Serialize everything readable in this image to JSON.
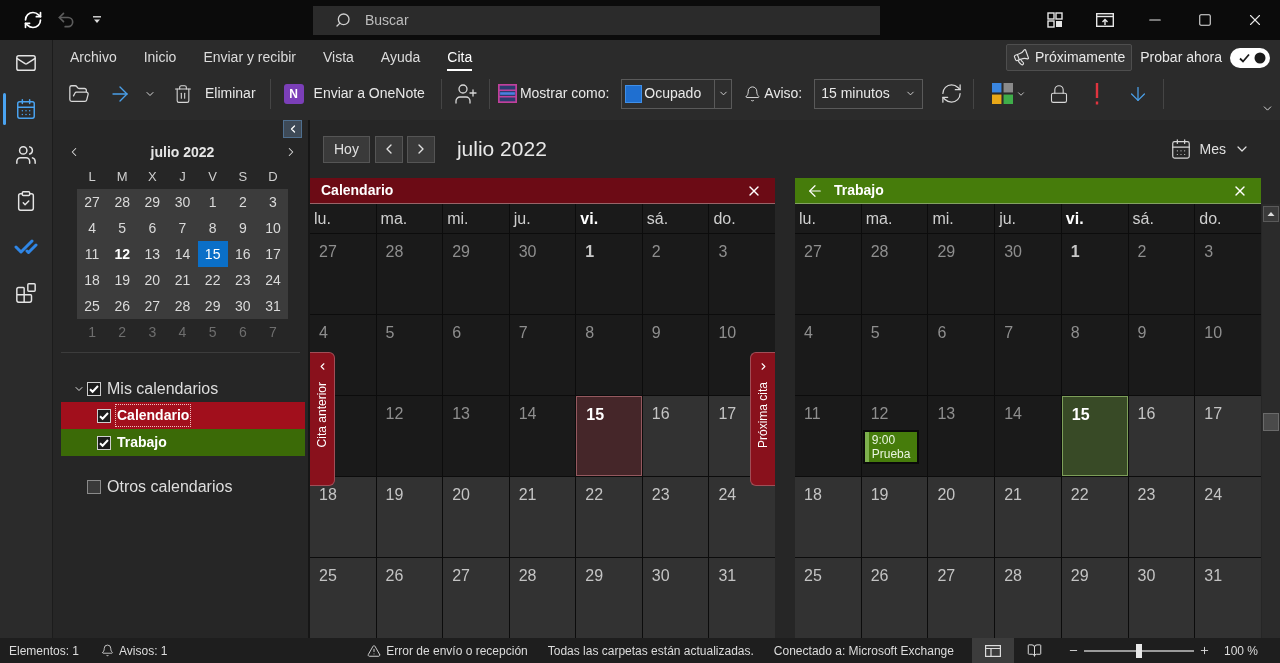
{
  "title_bar": {
    "search": {
      "placeholder": "Buscar"
    }
  },
  "nav_rail": {
    "items": [
      {
        "kind": "mail",
        "selected": false
      },
      {
        "kind": "calendar",
        "selected": true
      },
      {
        "kind": "people",
        "selected": false
      },
      {
        "kind": "tasks",
        "selected": false
      },
      {
        "kind": "todo",
        "selected": false
      },
      {
        "kind": "apps",
        "selected": false
      }
    ]
  },
  "ribbon": {
    "tabs": [
      {
        "label": "Archivo",
        "selected": false
      },
      {
        "label": "Inicio",
        "selected": false
      },
      {
        "label": "Enviar y recibir",
        "selected": false
      },
      {
        "label": "Vista",
        "selected": false
      },
      {
        "label": "Ayuda",
        "selected": false
      },
      {
        "label": "Cita",
        "selected": true
      }
    ],
    "coming_soon": {
      "label": "Próximamente"
    },
    "try_now": {
      "label": "Probar ahora",
      "on": true
    },
    "toolbar": {
      "delete": {
        "label": "Eliminar"
      },
      "onenote": {
        "logo": "N",
        "label": "Enviar a OneNote"
      },
      "show_as": {
        "label": "Mostrar como:",
        "value": "Ocupado"
      },
      "reminder": {
        "label": "Aviso:",
        "value": "15 minutos"
      }
    }
  },
  "mini_calendar": {
    "title": "julio 2022",
    "weekdays": [
      "L",
      "M",
      "X",
      "J",
      "V",
      "S",
      "D"
    ],
    "weeks": [
      {
        "dimmed": false,
        "days": [
          {
            "label": "27",
            "selected": false,
            "has_items": false
          },
          {
            "label": "28",
            "selected": false,
            "has_items": false
          },
          {
            "label": "29",
            "selected": false,
            "has_items": false
          },
          {
            "label": "30",
            "selected": false,
            "has_items": false
          },
          {
            "label": "1",
            "selected": false,
            "has_items": false
          },
          {
            "label": "2",
            "selected": false,
            "has_items": false
          },
          {
            "label": "3",
            "selected": false,
            "has_items": false
          }
        ]
      },
      {
        "dimmed": false,
        "days": [
          {
            "label": "4",
            "selected": false,
            "has_items": false
          },
          {
            "label": "5",
            "selected": false,
            "has_items": false
          },
          {
            "label": "6",
            "selected": false,
            "has_items": false
          },
          {
            "label": "7",
            "selected": false,
            "has_items": false
          },
          {
            "label": "8",
            "selected": false,
            "has_items": false
          },
          {
            "label": "9",
            "selected": false,
            "has_items": false
          },
          {
            "label": "10",
            "selected": false,
            "has_items": false
          }
        ]
      },
      {
        "dimmed": false,
        "days": [
          {
            "label": "11",
            "selected": false,
            "has_items": false
          },
          {
            "label": "12",
            "selected": false,
            "has_items": true
          },
          {
            "label": "13",
            "selected": false,
            "has_items": false
          },
          {
            "label": "14",
            "selected": false,
            "has_items": false
          },
          {
            "label": "15",
            "selected": true,
            "has_items": false
          },
          {
            "label": "16",
            "selected": false,
            "has_items": false
          },
          {
            "label": "17",
            "selected": false,
            "has_items": false
          }
        ]
      },
      {
        "dimmed": false,
        "days": [
          {
            "label": "18",
            "selected": false,
            "has_items": false
          },
          {
            "label": "19",
            "selected": false,
            "has_items": false
          },
          {
            "label": "20",
            "selected": false,
            "has_items": false
          },
          {
            "label": "21",
            "selected": false,
            "has_items": false
          },
          {
            "label": "22",
            "selected": false,
            "has_items": false
          },
          {
            "label": "23",
            "selected": false,
            "has_items": false
          },
          {
            "label": "24",
            "selected": false,
            "has_items": false
          }
        ]
      },
      {
        "dimmed": false,
        "days": [
          {
            "label": "25",
            "selected": false,
            "has_items": false
          },
          {
            "label": "26",
            "selected": false,
            "has_items": false
          },
          {
            "label": "27",
            "selected": false,
            "has_items": false
          },
          {
            "label": "28",
            "selected": false,
            "has_items": false
          },
          {
            "label": "29",
            "selected": false,
            "has_items": false
          },
          {
            "label": "30",
            "selected": false,
            "has_items": false
          },
          {
            "label": "31",
            "selected": false,
            "has_items": false
          }
        ]
      },
      {
        "dimmed": true,
        "days": [
          {
            "label": "1",
            "selected": false,
            "has_items": false
          },
          {
            "label": "2",
            "selected": false,
            "has_items": false
          },
          {
            "label": "3",
            "selected": false,
            "has_items": false
          },
          {
            "label": "4",
            "selected": false,
            "has_items": false
          },
          {
            "label": "5",
            "selected": false,
            "has_items": false
          },
          {
            "label": "6",
            "selected": false,
            "has_items": false
          },
          {
            "label": "7",
            "selected": false,
            "has_items": false
          }
        ]
      }
    ]
  },
  "calendar_list": [
    {
      "label": "Mis calendarios",
      "checked": true,
      "expanded": true,
      "children": [
        {
          "label": "Calendario",
          "checked": true,
          "focused": true,
          "color": "#a10f1c"
        },
        {
          "label": "Trabajo",
          "checked": true,
          "focused": false,
          "color": "#3b6a07"
        }
      ]
    },
    {
      "label": "Otros calendarios",
      "checked": false
    }
  ],
  "main": {
    "today_button": "Hoy",
    "title": "julio 2022",
    "view": "Mes",
    "panes": [
      {
        "kind": "primary",
        "name": "Calendario",
        "color": "#6c0b15",
        "previous_label": "Cita anterior",
        "next_label": "Próxima cita",
        "weekdays": [
          {
            "label": "lu.",
            "current": false
          },
          {
            "label": "ma.",
            "current": false
          },
          {
            "label": "mi.",
            "current": false
          },
          {
            "label": "ju.",
            "current": false
          },
          {
            "label": "vi.",
            "current": true
          },
          {
            "label": "sá.",
            "current": false
          },
          {
            "label": "do.",
            "current": false
          }
        ],
        "weeks": [
          [
            {
              "label": "27",
              "past": true,
              "today": false,
              "month_start": false
            },
            {
              "label": "28",
              "past": true,
              "today": false,
              "month_start": false
            },
            {
              "label": "29",
              "past": true,
              "today": false,
              "month_start": false
            },
            {
              "label": "30",
              "past": true,
              "today": false,
              "month_start": false
            },
            {
              "label": "1",
              "past": true,
              "today": false,
              "month_start": true
            },
            {
              "label": "2",
              "past": true,
              "today": false,
              "month_start": false
            },
            {
              "label": "3",
              "past": true,
              "today": false,
              "month_start": false
            }
          ],
          [
            {
              "label": "4",
              "past": true,
              "today": false,
              "month_start": false
            },
            {
              "label": "5",
              "past": true,
              "today": false,
              "month_start": false
            },
            {
              "label": "6",
              "past": true,
              "today": false,
              "month_start": false
            },
            {
              "label": "7",
              "past": true,
              "today": false,
              "month_start": false
            },
            {
              "label": "8",
              "past": true,
              "today": false,
              "month_start": false
            },
            {
              "label": "9",
              "past": true,
              "today": false,
              "month_start": false
            },
            {
              "label": "10",
              "past": true,
              "today": false,
              "month_start": false
            }
          ],
          [
            {
              "past": true,
              "today": false,
              "month_start": false
            },
            {
              "label": "12",
              "past": true,
              "today": false,
              "month_start": false
            },
            {
              "label": "13",
              "past": true,
              "today": false,
              "month_start": false
            },
            {
              "label": "14",
              "past": true,
              "today": false,
              "month_start": false
            },
            {
              "label": "15",
              "past": false,
              "today": true,
              "month_start": false
            },
            {
              "label": "16",
              "past": false,
              "today": false,
              "month_start": false
            },
            {
              "label": "17",
              "past": false,
              "today": false,
              "month_start": false
            }
          ],
          [
            {
              "label": "18",
              "past": false,
              "today": false,
              "month_start": false
            },
            {
              "label": "19",
              "past": false,
              "today": false,
              "month_start": false
            },
            {
              "label": "20",
              "past": false,
              "today": false,
              "month_start": false
            },
            {
              "label": "21",
              "past": false,
              "today": false,
              "month_start": false
            },
            {
              "label": "22",
              "past": false,
              "today": false,
              "month_start": false
            },
            {
              "label": "23",
              "past": false,
              "today": false,
              "month_start": false
            },
            {
              "label": "24",
              "past": false,
              "today": false,
              "month_start": false
            }
          ],
          [
            {
              "label": "25",
              "past": false,
              "today": false,
              "month_start": false
            },
            {
              "label": "26",
              "past": false,
              "today": false,
              "month_start": false
            },
            {
              "label": "27",
              "past": false,
              "today": false,
              "month_start": false
            },
            {
              "label": "28",
              "past": false,
              "today": false,
              "month_start": false
            },
            {
              "label": "29",
              "past": false,
              "today": false,
              "month_start": false
            },
            {
              "label": "30",
              "past": false,
              "today": false,
              "month_start": false
            },
            {
              "label": "31",
              "past": false,
              "today": false,
              "month_start": false
            }
          ]
        ]
      },
      {
        "kind": "overlay",
        "name": "Trabajo",
        "color": "#467c0b",
        "weekdays": [
          {
            "label": "lu.",
            "current": false
          },
          {
            "label": "ma.",
            "current": false
          },
          {
            "label": "mi.",
            "current": false
          },
          {
            "label": "ju.",
            "current": false
          },
          {
            "label": "vi.",
            "current": true
          },
          {
            "label": "sá.",
            "current": false
          },
          {
            "label": "do.",
            "current": false
          }
        ],
        "weeks": [
          [
            {
              "label": "27",
              "past": true,
              "today": false,
              "month_start": false
            },
            {
              "label": "28",
              "past": true,
              "today": false,
              "month_start": false
            },
            {
              "label": "29",
              "past": true,
              "today": false,
              "month_start": false
            },
            {
              "label": "30",
              "past": true,
              "today": false,
              "month_start": false
            },
            {
              "label": "1",
              "past": true,
              "today": false,
              "month_start": true
            },
            {
              "label": "2",
              "past": true,
              "today": false,
              "month_start": false
            },
            {
              "label": "3",
              "past": true,
              "today": false,
              "month_start": false
            }
          ],
          [
            {
              "label": "4",
              "past": true,
              "today": false,
              "month_start": false
            },
            {
              "label": "5",
              "past": true,
              "today": false,
              "month_start": false
            },
            {
              "label": "6",
              "past": true,
              "today": false,
              "month_start": false
            },
            {
              "label": "7",
              "past": true,
              "today": false,
              "month_start": false
            },
            {
              "label": "8",
              "past": true,
              "today": false,
              "month_start": false
            },
            {
              "label": "9",
              "past": true,
              "today": false,
              "month_start": false
            },
            {
              "label": "10",
              "past": true,
              "today": false,
              "month_start": false
            }
          ],
          [
            {
              "label": "11",
              "past": true,
              "today": false,
              "month_start": false
            },
            {
              "label": "12",
              "past": true,
              "today": false,
              "month_start": false,
              "events": [
                {
                  "time": "9:00",
                  "title": "Prueba"
                }
              ]
            },
            {
              "label": "13",
              "past": true,
              "today": false,
              "month_start": false
            },
            {
              "label": "14",
              "past": true,
              "today": false,
              "month_start": false
            },
            {
              "label": "15",
              "past": false,
              "today": true,
              "month_start": false
            },
            {
              "label": "16",
              "past": false,
              "today": false,
              "month_start": false
            },
            {
              "label": "17",
              "past": false,
              "today": false,
              "month_start": false
            }
          ],
          [
            {
              "label": "18",
              "past": false,
              "today": false,
              "month_start": false
            },
            {
              "label": "19",
              "past": false,
              "today": false,
              "month_start": false
            },
            {
              "label": "20",
              "past": false,
              "today": false,
              "month_start": false
            },
            {
              "label": "21",
              "past": false,
              "today": false,
              "month_start": false
            },
            {
              "label": "22",
              "past": false,
              "today": false,
              "month_start": false
            },
            {
              "label": "23",
              "past": false,
              "today": false,
              "month_start": false
            },
            {
              "label": "24",
              "past": false,
              "today": false,
              "month_start": false
            }
          ],
          [
            {
              "label": "25",
              "past": false,
              "today": false,
              "month_start": false
            },
            {
              "label": "26",
              "past": false,
              "today": false,
              "month_start": false
            },
            {
              "label": "27",
              "past": false,
              "today": false,
              "month_start": false
            },
            {
              "label": "28",
              "past": false,
              "today": false,
              "month_start": false
            },
            {
              "label": "29",
              "past": false,
              "today": false,
              "month_start": false
            },
            {
              "label": "30",
              "past": false,
              "today": false,
              "month_start": false
            },
            {
              "label": "31",
              "past": false,
              "today": false,
              "month_start": false
            }
          ]
        ]
      }
    ]
  },
  "status_bar": {
    "left": [
      {
        "kind": "plain",
        "text": "Elementos: 1"
      },
      {
        "kind": "reminders",
        "text": "Avisos: 1"
      }
    ],
    "right": [
      {
        "kind": "error",
        "text": "Error de envío o recepción"
      },
      {
        "kind": "plain",
        "text": "Todas las carpetas están actualizadas."
      },
      {
        "kind": "plain",
        "text": "Conectado a: Microsoft Exchange"
      }
    ],
    "views": [
      {
        "kind": "normal",
        "selected": true
      },
      {
        "kind": "reading",
        "selected": false
      }
    ],
    "zoom": {
      "level": 0.5,
      "reading": "100 %"
    }
  }
}
